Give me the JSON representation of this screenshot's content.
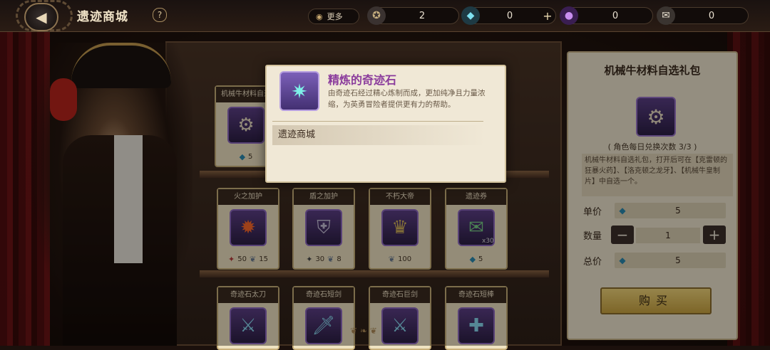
{
  "header": {
    "title": "遗迹商城",
    "help": "?",
    "more_label": "更多",
    "currencies": [
      {
        "icon": "medal-icon",
        "value": "2",
        "has_plus": false
      },
      {
        "icon": "crystal-icon",
        "value": "0",
        "has_plus": true
      },
      {
        "icon": "purple-orb-icon",
        "value": "0",
        "has_plus": false
      },
      {
        "icon": "scroll-icon",
        "value": "0",
        "has_plus": false
      }
    ]
  },
  "shop": {
    "row1": [
      {
        "name": "机械牛材料自选",
        "icon": "gear-chest-icon",
        "costs": [
          {
            "icon": "crystal-icon",
            "value": "5"
          }
        ]
      }
    ],
    "row2": [
      {
        "name": "火之加护",
        "icon": "fire-icon",
        "costs": [
          {
            "icon": "red-emblem-icon",
            "value": "50"
          },
          {
            "icon": "wing-icon",
            "value": "15"
          }
        ]
      },
      {
        "name": "盾之加护",
        "icon": "shield-icon",
        "costs": [
          {
            "icon": "dark-emblem-icon",
            "value": "30"
          },
          {
            "icon": "wing-icon",
            "value": "8"
          }
        ]
      },
      {
        "name": "不朽大帝",
        "icon": "mask-icon",
        "costs": [
          {
            "icon": "wing-icon",
            "value": "100"
          }
        ]
      },
      {
        "name": "遗迹券",
        "icon": "ticket-icon",
        "qty": "x30",
        "costs": [
          {
            "icon": "crystal-icon",
            "value": "5"
          }
        ]
      }
    ],
    "row3": [
      {
        "name": "奇迹石太刀"
      },
      {
        "name": "奇迹石短剑"
      },
      {
        "name": "奇迹石巨剑"
      },
      {
        "name": "奇迹石短棒"
      }
    ]
  },
  "detail": {
    "title": "机械牛材料自选礼包",
    "limit": "( 角色每日兑换次数 3/3 )",
    "description": "机械牛材料自选礼包，打开后可在【克雷顿的狂暴火药】、【洛克顿之龙牙】、【机械牛皇制片】中自选一个。",
    "unit_price_label": "单价",
    "unit_price": "5",
    "quantity_label": "数量",
    "quantity": "1",
    "minus": "−",
    "plus": "+",
    "total_label": "总价",
    "total": "5",
    "buy_label": "购买"
  },
  "tooltip": {
    "name": "精炼的奇迹石",
    "description": "由奇迹石经过精心炼制而成，更加纯净且力量浓缩，为英勇冒险者提供更有力的帮助。",
    "source": "遗迹商城"
  },
  "colors": {
    "rarity_name": "#8a3b9c",
    "buy_button": "#e6c45c"
  }
}
